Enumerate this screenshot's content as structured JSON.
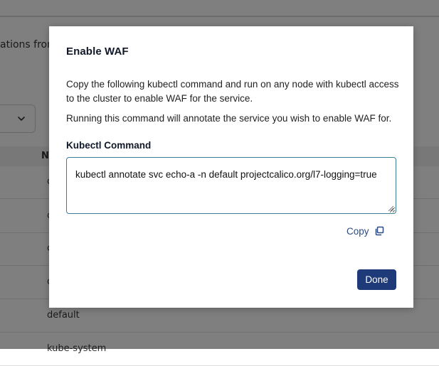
{
  "background": {
    "description_fragment": "ations from",
    "table_header_fragment": "Na",
    "rows": [
      "c",
      "c",
      "c",
      "c",
      "default",
      "kube-system"
    ]
  },
  "modal": {
    "title": "Enable WAF",
    "paragraph_1": "Copy the following kubectl command and run on any node with kubectl access to the cluster to enable WAF for the service.",
    "paragraph_2": "Running this command will annotate the service you wish to enable WAF for.",
    "field_label": "Kubectl Command",
    "command_value": "kubectl annotate svc echo-a -n default projectcalico.org/l7-logging=true",
    "copy_label": "Copy",
    "done_label": "Done"
  },
  "colors": {
    "primary_button": "#1f3a79",
    "link": "#2b4a80",
    "field_border": "#3b8196",
    "overlay": "rgba(0,0,0,0.5)"
  },
  "icons": {
    "copy": "copy-icon",
    "select_chevron": "chevron-down-icon"
  }
}
